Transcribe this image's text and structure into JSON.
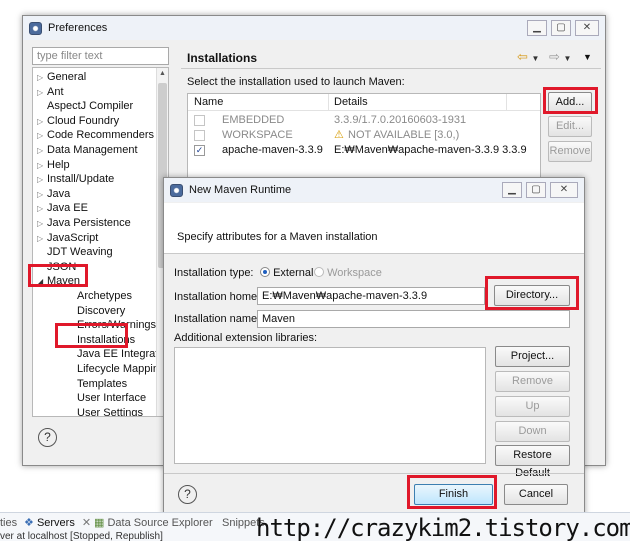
{
  "prefs": {
    "title": "Preferences",
    "filter_placeholder": "type filter text",
    "tree": [
      {
        "label": "General",
        "expand": "▷",
        "indent": 0
      },
      {
        "label": "Ant",
        "expand": "▷",
        "indent": 0
      },
      {
        "label": "AspectJ Compiler",
        "expand": "",
        "indent": 0
      },
      {
        "label": "Cloud Foundry",
        "expand": "▷",
        "indent": 0
      },
      {
        "label": "Code Recommenders",
        "expand": "▷",
        "indent": 0
      },
      {
        "label": "Data Management",
        "expand": "▷",
        "indent": 0
      },
      {
        "label": "Help",
        "expand": "▷",
        "indent": 0
      },
      {
        "label": "Install/Update",
        "expand": "▷",
        "indent": 0
      },
      {
        "label": "Java",
        "expand": "▷",
        "indent": 0
      },
      {
        "label": "Java EE",
        "expand": "▷",
        "indent": 0
      },
      {
        "label": "Java Persistence",
        "expand": "▷",
        "indent": 0
      },
      {
        "label": "JavaScript",
        "expand": "▷",
        "indent": 0
      },
      {
        "label": "JDT Weaving",
        "expand": "",
        "indent": 0
      },
      {
        "label": "JSON",
        "expand": "",
        "indent": 0
      },
      {
        "label": "Maven",
        "expand": "◢",
        "indent": 0
      },
      {
        "label": "Archetypes",
        "expand": "",
        "indent": 1
      },
      {
        "label": "Discovery",
        "expand": "",
        "indent": 1
      },
      {
        "label": "Errors/Warnings",
        "expand": "",
        "indent": 1
      },
      {
        "label": "Installations",
        "expand": "",
        "indent": 1
      },
      {
        "label": "Java EE Integration",
        "expand": "",
        "indent": 1
      },
      {
        "label": "Lifecycle Mappings",
        "expand": "",
        "indent": 1
      },
      {
        "label": "Templates",
        "expand": "",
        "indent": 1
      },
      {
        "label": "User Interface",
        "expand": "",
        "indent": 1
      },
      {
        "label": "User Settings",
        "expand": "",
        "indent": 1
      }
    ],
    "page_title": "Installations",
    "instruction": "Select the installation used to launch Maven:",
    "columns": [
      "Name",
      "Details"
    ],
    "rows": [
      {
        "name": "EMBEDDED",
        "details": "3.3.9/1.7.0.20160603-1931",
        "checked": false,
        "warn": false,
        "disabled": true
      },
      {
        "name": "WORKSPACE",
        "details": "NOT AVAILABLE [3.0,)",
        "checked": false,
        "warn": true,
        "disabled": true
      },
      {
        "name": "apache-maven-3.3.9",
        "details": "E:₩Maven₩apache-maven-3.3.9 3.3.9",
        "checked": true,
        "warn": false,
        "disabled": false
      }
    ],
    "add_label": "Add...",
    "edit_label": "Edit...",
    "remove_label": "Remove"
  },
  "runtime": {
    "title": "New Maven Runtime",
    "description": "Specify attributes for a Maven installation",
    "type_label": "Installation type:",
    "type_external": "External",
    "type_workspace": "Workspace",
    "home_label": "Installation home:",
    "home_value": "E:₩Maven₩apache-maven-3.3.9",
    "directory_label": "Directory...",
    "name_label": "Installation name:",
    "name_value": "Maven",
    "libs_label": "Additional extension libraries:",
    "project_label": "Project...",
    "remove_label": "Remove",
    "up_label": "Up",
    "down_label": "Down",
    "restore_label": "Restore Default",
    "finish_label": "Finish",
    "cancel_label": "Cancel"
  },
  "bottom": {
    "tab_props": "ties",
    "tab_servers": "Servers",
    "tab_datasource": "Data Source Explorer",
    "tab_snippets": "Snippets",
    "status_line": "ver at localhost  [Stopped, Republish]",
    "watermark": "http://crazykim2.tistory.com/"
  },
  "colors": {
    "highlight": "#e0182a",
    "selection": "#cce4f7"
  }
}
